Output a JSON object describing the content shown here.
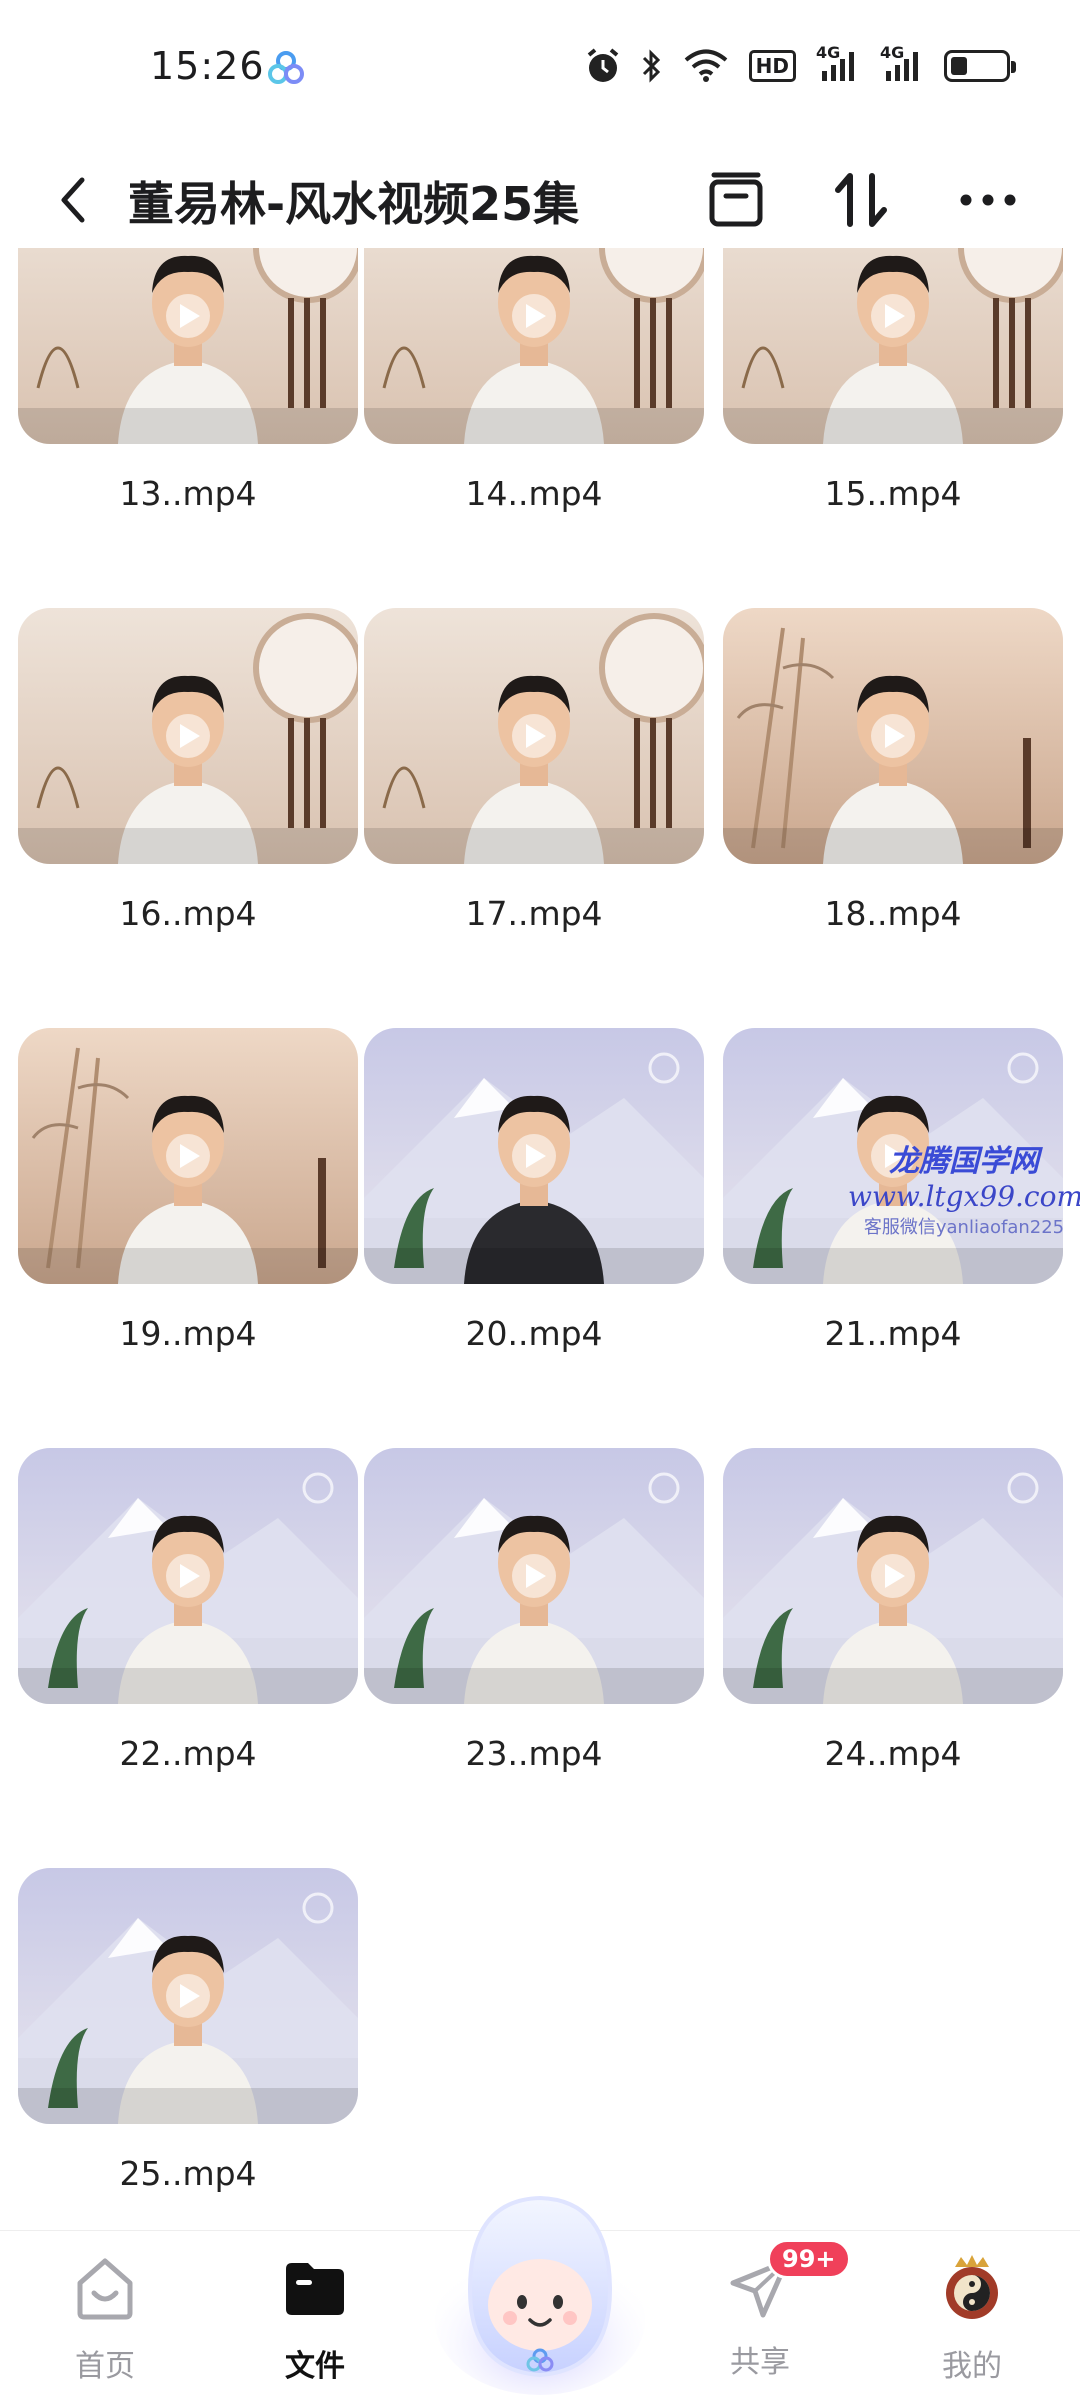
{
  "status_bar": {
    "time": "15:26",
    "hd_label": "HD",
    "network_labels": [
      "4G",
      "4G"
    ],
    "battery_level": 0.3
  },
  "header": {
    "title": "董易林-风水视频25集",
    "icons": [
      "back-chevron-icon",
      "archive-box-icon",
      "sort-icon",
      "more-icon"
    ]
  },
  "files": [
    {
      "name": "13..mp4",
      "scene": "desk",
      "outfit": "white"
    },
    {
      "name": "14..mp4",
      "scene": "desk",
      "outfit": "white"
    },
    {
      "name": "15..mp4",
      "scene": "desk",
      "outfit": "white"
    },
    {
      "name": "16..mp4",
      "scene": "desk",
      "outfit": "white"
    },
    {
      "name": "17..mp4",
      "scene": "desk",
      "outfit": "white"
    },
    {
      "name": "18..mp4",
      "scene": "bamboo",
      "outfit": "white"
    },
    {
      "name": "19..mp4",
      "scene": "bamboo",
      "outfit": "white"
    },
    {
      "name": "20..mp4",
      "scene": "mountain",
      "outfit": "black"
    },
    {
      "name": "21..mp4",
      "scene": "mountain",
      "outfit": "white"
    },
    {
      "name": "22..mp4",
      "scene": "mountain",
      "outfit": "white"
    },
    {
      "name": "23..mp4",
      "scene": "mountain",
      "outfit": "white"
    },
    {
      "name": "24..mp4",
      "scene": "mountain",
      "outfit": "white"
    },
    {
      "name": "25..mp4",
      "scene": "mountain",
      "outfit": "white"
    }
  ],
  "watermark": {
    "line1": "龙腾国学网",
    "line2": "www.ltgx99.com",
    "line3": "客服微信yanliaofan225"
  },
  "bottom_nav": {
    "items": [
      {
        "label": "首页",
        "icon": "home-smile-icon",
        "active": false
      },
      {
        "label": "文件",
        "icon": "folder-icon",
        "active": true
      },
      {
        "label": "共享",
        "icon": "paper-plane-icon",
        "active": false,
        "badge": "99+"
      },
      {
        "label": "我的",
        "icon": "avatar-icon",
        "active": false
      }
    ],
    "assistant_icon": "assistant-mascot-icon"
  },
  "colors": {
    "accent": "#f0405a",
    "text_primary": "#1d1d1f",
    "text_secondary": "#9a9aa0"
  }
}
